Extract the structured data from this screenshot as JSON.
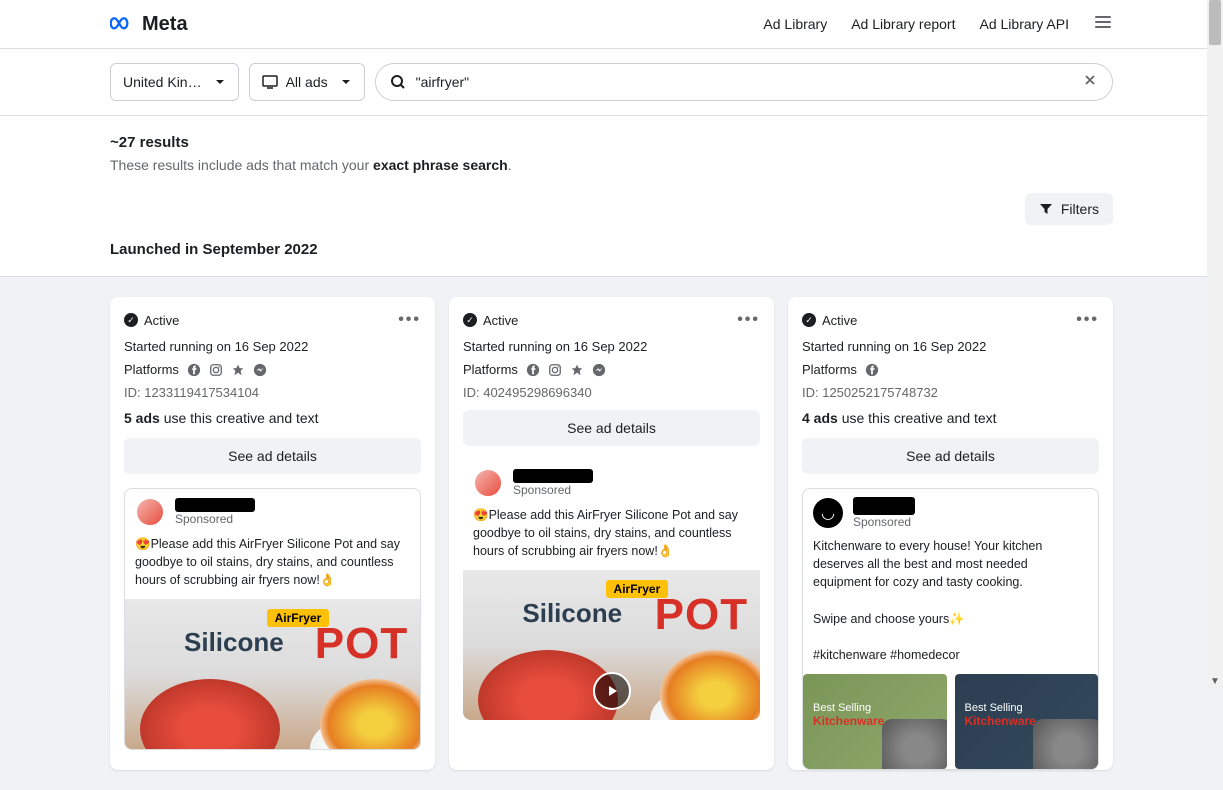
{
  "brand": "Meta",
  "nav": {
    "ad_library": "Ad Library",
    "ad_library_report": "Ad Library report",
    "ad_library_api": "Ad Library API"
  },
  "filters": {
    "country": "United Kin…",
    "ad_type": "All ads",
    "filters_label": "Filters"
  },
  "search": {
    "value": "\"airfryer\""
  },
  "results": {
    "count": "~27 results",
    "subtitle_prefix": "These results include ads that match your ",
    "subtitle_bold": "exact phrase search",
    "subtitle_suffix": "."
  },
  "section_title": "Launched in September 2022",
  "cards": [
    {
      "status": "Active",
      "started": "Started running on 16 Sep 2022",
      "platforms_label": "Platforms",
      "id": "ID: 1233119417534104",
      "creative_count_bold": "5 ads",
      "creative_count_rest": " use this creative and text",
      "see_details": "See ad details",
      "sponsored": "Sponsored",
      "ad_text": "😍Please add this AirFryer Silicone Pot and say goodbye to oil stains, dry stains, and countless hours of scrubbing air fryers now!👌",
      "platforms": [
        "facebook",
        "instagram",
        "audience",
        "messenger"
      ],
      "airfryer_label": "AirFryer",
      "silicone_label": "Silicone",
      "pot_label": "POT"
    },
    {
      "status": "Active",
      "started": "Started running on 16 Sep 2022",
      "platforms_label": "Platforms",
      "id": "ID: 402495298696340",
      "see_details": "See ad details",
      "sponsored": "Sponsored",
      "ad_text": "😍Please add this AirFryer Silicone Pot and say goodbye to oil stains, dry stains, and countless hours of scrubbing air fryers now!👌",
      "platforms": [
        "facebook",
        "instagram",
        "audience",
        "messenger"
      ],
      "airfryer_label": "AirFryer",
      "silicone_label": "Silicone",
      "pot_label": "POT"
    },
    {
      "status": "Active",
      "started": "Started running on 16 Sep 2022",
      "platforms_label": "Platforms",
      "id": "ID: 1250252175748732",
      "creative_count_bold": "4 ads",
      "creative_count_rest": " use this creative and text",
      "see_details": "See ad details",
      "sponsored": "Sponsored",
      "ad_text_1": "Kitchenware to every house! Your kitchen deserves all the best and most needed equipment for cozy and tasty cooking.",
      "ad_text_2": "Swipe and choose yours✨",
      "ad_text_3": "#kitchenware #homedecor",
      "platforms": [
        "facebook"
      ],
      "tile_label_top": "Best Selling",
      "tile_label_bottom": "Kitchenware"
    }
  ]
}
